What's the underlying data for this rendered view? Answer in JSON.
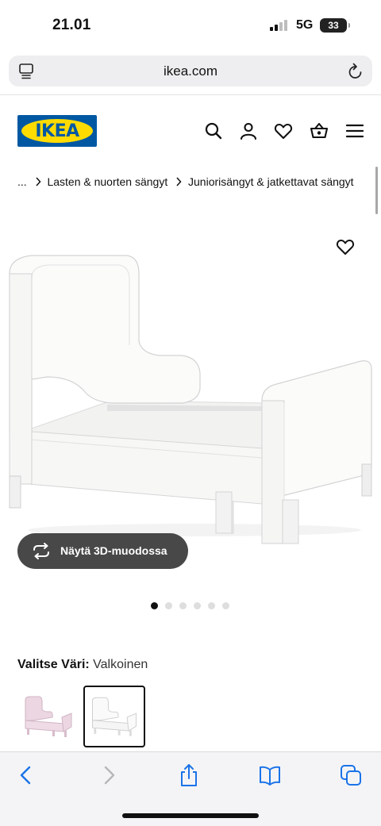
{
  "status": {
    "time": "21.01",
    "network": "5G",
    "battery": "33"
  },
  "browser": {
    "url": "ikea.com"
  },
  "brand": {
    "logo_text": "IKEA",
    "blue": "#0058a3",
    "yellow": "#ffdb00"
  },
  "header_icons": [
    "search-icon",
    "account-icon",
    "heart-icon",
    "basket-icon",
    "menu-icon"
  ],
  "breadcrumb": {
    "ellipsis": "...",
    "items": [
      "Lasten & nuorten sängyt",
      "Juniorisängyt & jatkettavat sängyt"
    ]
  },
  "product": {
    "view_3d_label": "Näytä 3D-muodossa",
    "image_count": 6,
    "active_image": 1,
    "color_label": "Valitse Väri:",
    "color_value": "Valkoinen",
    "swatches": [
      {
        "color": "#e9d2df",
        "selected": false
      },
      {
        "color": "#f6f6f4",
        "selected": true
      }
    ]
  },
  "toolbar_icons": [
    "back-icon",
    "forward-icon",
    "share-icon",
    "bookmarks-icon",
    "tabs-icon"
  ]
}
